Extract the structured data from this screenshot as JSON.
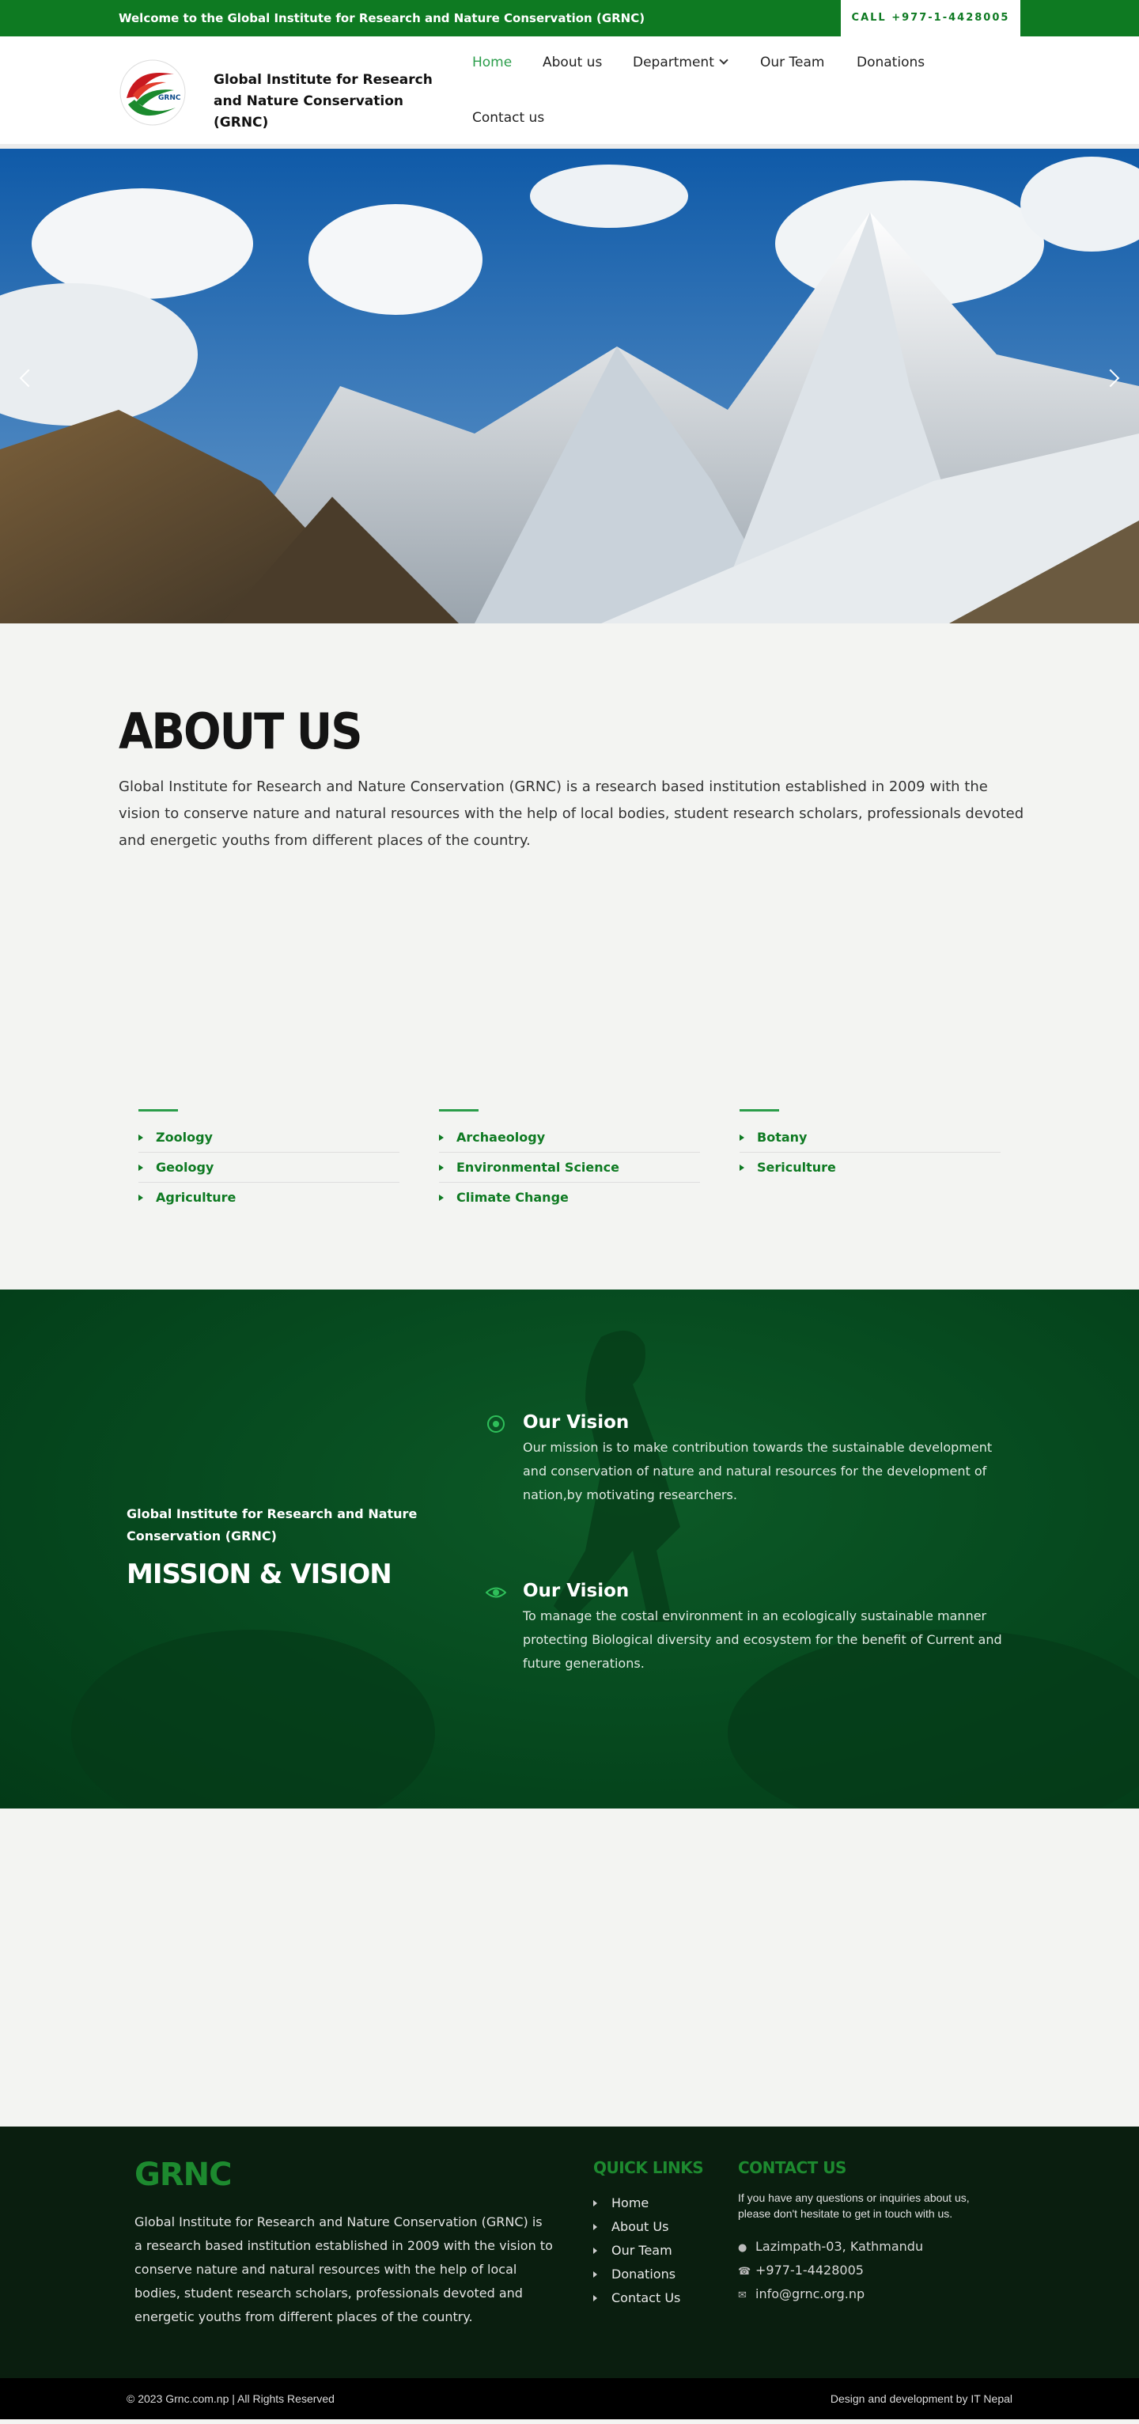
{
  "topbar": {
    "welcome": "Welcome to the Global Institute for Research and Nature Conservation (GRNC)",
    "call": "CALL +977-1-4428005"
  },
  "header": {
    "brand": "Global Institute for Research and Nature Conservation (GRNC)",
    "logo_icon": "grnc-logo-icon",
    "logo_text": "GRNC",
    "nav": {
      "home": "Home",
      "about": "About us",
      "department": "Department",
      "team": "Our Team",
      "donations": "Donations",
      "contact": "Contact us"
    },
    "active": "Home",
    "accent_color": "#2a9d4a"
  },
  "hero": {
    "prev_icon": "chevron-left-icon",
    "next_icon": "chevron-right-icon"
  },
  "about": {
    "title": "ABOUT US",
    "text": "Global Institute for Research and Nature Conservation (GRNC) is a  research based institution established in 2009 with the vision to conserve nature and natural resources with the help of local bodies, student research scholars, professionals devoted and energetic youths from different places of the country."
  },
  "departments": {
    "col1": [
      "Zoology",
      "Geology",
      "Agriculture"
    ],
    "col2": [
      "Archaeology",
      "Environmental Science",
      "Climate Change"
    ],
    "col3": [
      "Botany",
      "Sericulture"
    ]
  },
  "mission": {
    "org": "Global Institute for Research and Nature Conservation (GRNC)",
    "title": "MISSION & VISION",
    "items": [
      {
        "icon": "target-icon",
        "title": "Our Vision",
        "text": "Our mission is to make contribution towards the sustainable development and conservation of nature and natural resources for the development of nation,by motivating researchers."
      },
      {
        "icon": "eye-icon",
        "title": "Our Vision",
        "text": "To manage the costal environment in an ecologically sustainable manner protecting Biological diversity and ecosystem for the benefit of Current and future generations."
      }
    ]
  },
  "footer": {
    "logo": "GRNC",
    "desc": "Global Institute for Research and Nature Conservation (GRNC) is a  research based institution established in 2009 with the vision to conserve nature and natural resources with the help of local bodies, student research scholars, professionals devoted and energetic youths from different places of the country.",
    "quick_links_title": "QUICK LINKS",
    "quick_links": [
      "Home",
      "About Us",
      "Our Team",
      "Donations",
      "Contact Us"
    ],
    "contact_title": "CONTACT US",
    "contact_intro": "If you have any questions or inquiries about us, please don't hesitate to get in touch with us.",
    "address": "Lazimpath-03, Kathmandu",
    "phone": "+977-1-4428005",
    "email": "info@grnc.org.np",
    "copyright": "© 2023 Grnc.com.np | All Rights Reserved",
    "credit": "Design and development by IT Nepal"
  }
}
